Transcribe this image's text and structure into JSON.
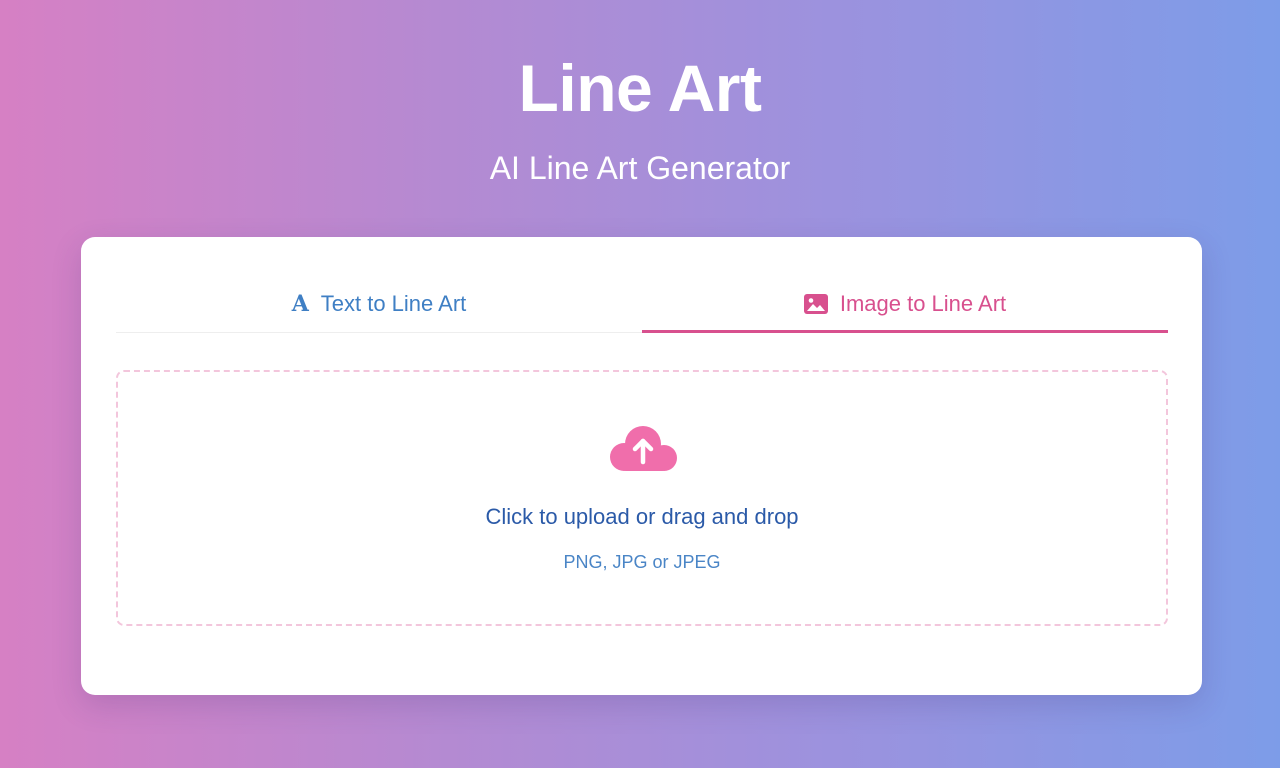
{
  "header": {
    "title": "Line Art",
    "subtitle": "AI Line Art Generator"
  },
  "tabs": [
    {
      "label": "Text to Line Art",
      "icon": "font-icon",
      "active": false,
      "color": "#3f7fc4"
    },
    {
      "label": "Image to Line Art",
      "icon": "image-icon",
      "active": true,
      "color": "#d8508e"
    }
  ],
  "upload": {
    "icon": "cloud-upload-icon",
    "title": "Click to upload or drag and drop",
    "hint": "PNG, JPG or JPEG"
  },
  "colors": {
    "accent": "#d8508e",
    "link": "#3f7fc4",
    "background_start": "#d680c4",
    "background_end": "#7d9ce8"
  }
}
